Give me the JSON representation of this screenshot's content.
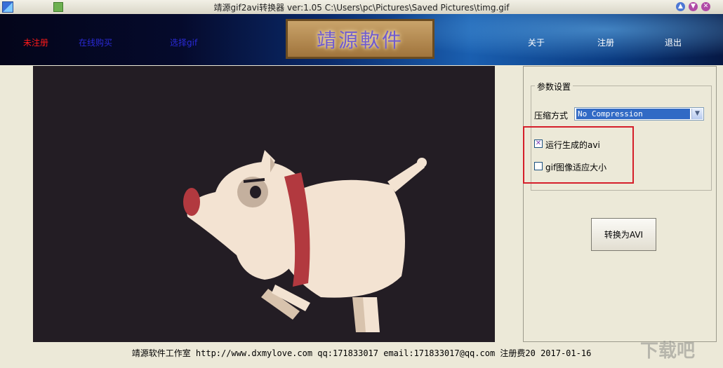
{
  "titlebar": {
    "title": "靖源gif2avi转换器 ver:1.05 C:\\Users\\pc\\Pictures\\Saved Pictures\\timg.gif",
    "buttons": [
      "▲",
      "▼",
      "✕"
    ]
  },
  "banner": {
    "nav": {
      "unregistered": "未注册",
      "buy_online": "在线购买",
      "select_gif": "选择gif",
      "about": "关于",
      "register": "注册",
      "exit": "退出"
    },
    "logo_text": "靖源軟件"
  },
  "settings": {
    "group_title": "参数设置",
    "compression_label": "压缩方式",
    "compression_value": "No Compression",
    "run_avi_label": "运行生成的avi",
    "run_avi_checked": true,
    "fit_size_label": "gif图像适应大小",
    "fit_size_checked": false
  },
  "actions": {
    "convert_label": "转换为AVI"
  },
  "footer": {
    "text": "靖源软件工作室 http://www.dxmylove.com qq:171833017 email:171833017@qq.com 注册费20 2017-01-16"
  },
  "watermark": "下载吧",
  "colors": {
    "unregistered": "#ff1a1a",
    "nav_blue": "#2a2ad6",
    "nav_white": "#ffffff",
    "checkbox_mark": "#7b3db8",
    "highlight_box": "#d51f2a"
  }
}
